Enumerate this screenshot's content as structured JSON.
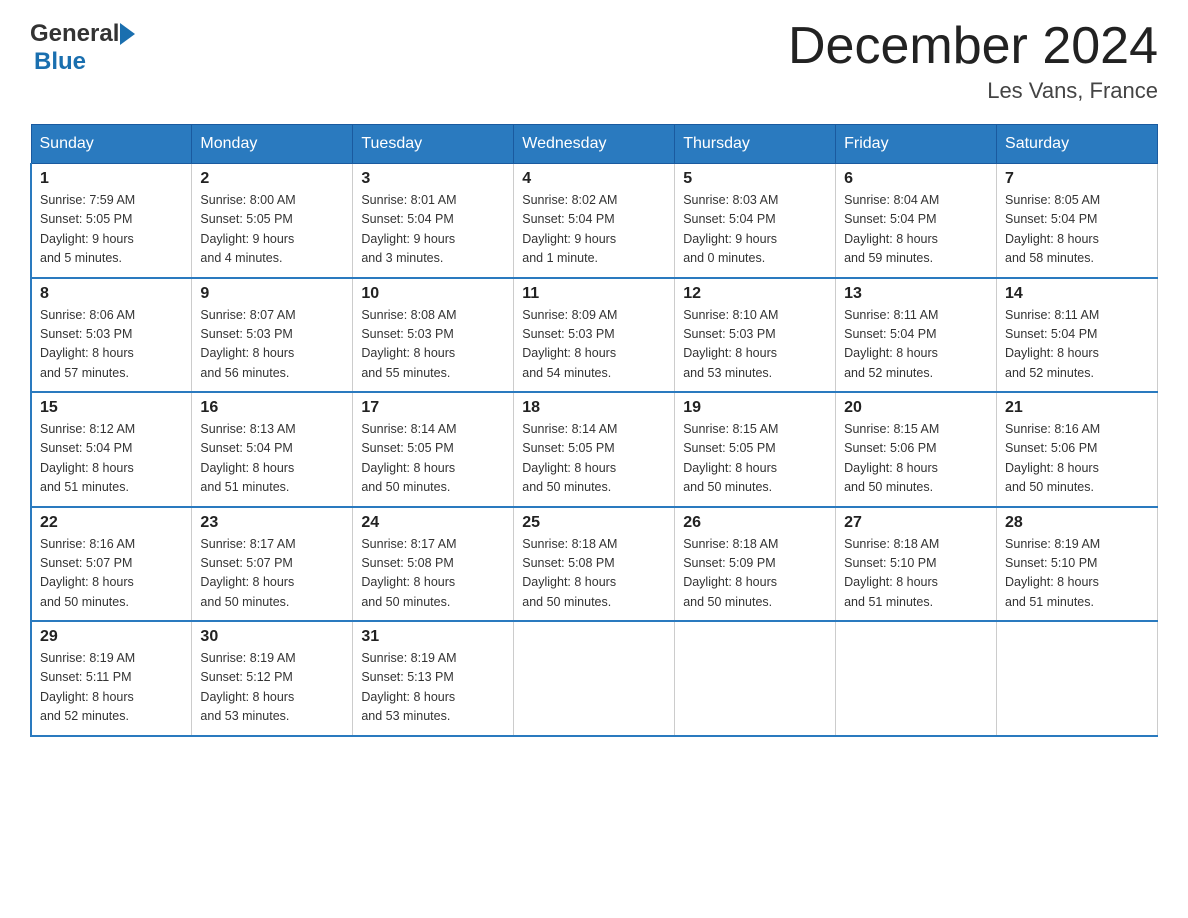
{
  "header": {
    "logo_general": "General",
    "logo_blue": "Blue",
    "month_title": "December 2024",
    "location": "Les Vans, France"
  },
  "days_of_week": [
    "Sunday",
    "Monday",
    "Tuesday",
    "Wednesday",
    "Thursday",
    "Friday",
    "Saturday"
  ],
  "weeks": [
    [
      {
        "day": "1",
        "sunrise": "Sunrise: 7:59 AM",
        "sunset": "Sunset: 5:05 PM",
        "daylight": "Daylight: 9 hours and 5 minutes."
      },
      {
        "day": "2",
        "sunrise": "Sunrise: 8:00 AM",
        "sunset": "Sunset: 5:05 PM",
        "daylight": "Daylight: 9 hours and 4 minutes."
      },
      {
        "day": "3",
        "sunrise": "Sunrise: 8:01 AM",
        "sunset": "Sunset: 5:04 PM",
        "daylight": "Daylight: 9 hours and 3 minutes."
      },
      {
        "day": "4",
        "sunrise": "Sunrise: 8:02 AM",
        "sunset": "Sunset: 5:04 PM",
        "daylight": "Daylight: 9 hours and 1 minute."
      },
      {
        "day": "5",
        "sunrise": "Sunrise: 8:03 AM",
        "sunset": "Sunset: 5:04 PM",
        "daylight": "Daylight: 9 hours and 0 minutes."
      },
      {
        "day": "6",
        "sunrise": "Sunrise: 8:04 AM",
        "sunset": "Sunset: 5:04 PM",
        "daylight": "Daylight: 8 hours and 59 minutes."
      },
      {
        "day": "7",
        "sunrise": "Sunrise: 8:05 AM",
        "sunset": "Sunset: 5:04 PM",
        "daylight": "Daylight: 8 hours and 58 minutes."
      }
    ],
    [
      {
        "day": "8",
        "sunrise": "Sunrise: 8:06 AM",
        "sunset": "Sunset: 5:03 PM",
        "daylight": "Daylight: 8 hours and 57 minutes."
      },
      {
        "day": "9",
        "sunrise": "Sunrise: 8:07 AM",
        "sunset": "Sunset: 5:03 PM",
        "daylight": "Daylight: 8 hours and 56 minutes."
      },
      {
        "day": "10",
        "sunrise": "Sunrise: 8:08 AM",
        "sunset": "Sunset: 5:03 PM",
        "daylight": "Daylight: 8 hours and 55 minutes."
      },
      {
        "day": "11",
        "sunrise": "Sunrise: 8:09 AM",
        "sunset": "Sunset: 5:03 PM",
        "daylight": "Daylight: 8 hours and 54 minutes."
      },
      {
        "day": "12",
        "sunrise": "Sunrise: 8:10 AM",
        "sunset": "Sunset: 5:03 PM",
        "daylight": "Daylight: 8 hours and 53 minutes."
      },
      {
        "day": "13",
        "sunrise": "Sunrise: 8:11 AM",
        "sunset": "Sunset: 5:04 PM",
        "daylight": "Daylight: 8 hours and 52 minutes."
      },
      {
        "day": "14",
        "sunrise": "Sunrise: 8:11 AM",
        "sunset": "Sunset: 5:04 PM",
        "daylight": "Daylight: 8 hours and 52 minutes."
      }
    ],
    [
      {
        "day": "15",
        "sunrise": "Sunrise: 8:12 AM",
        "sunset": "Sunset: 5:04 PM",
        "daylight": "Daylight: 8 hours and 51 minutes."
      },
      {
        "day": "16",
        "sunrise": "Sunrise: 8:13 AM",
        "sunset": "Sunset: 5:04 PM",
        "daylight": "Daylight: 8 hours and 51 minutes."
      },
      {
        "day": "17",
        "sunrise": "Sunrise: 8:14 AM",
        "sunset": "Sunset: 5:05 PM",
        "daylight": "Daylight: 8 hours and 50 minutes."
      },
      {
        "day": "18",
        "sunrise": "Sunrise: 8:14 AM",
        "sunset": "Sunset: 5:05 PM",
        "daylight": "Daylight: 8 hours and 50 minutes."
      },
      {
        "day": "19",
        "sunrise": "Sunrise: 8:15 AM",
        "sunset": "Sunset: 5:05 PM",
        "daylight": "Daylight: 8 hours and 50 minutes."
      },
      {
        "day": "20",
        "sunrise": "Sunrise: 8:15 AM",
        "sunset": "Sunset: 5:06 PM",
        "daylight": "Daylight: 8 hours and 50 minutes."
      },
      {
        "day": "21",
        "sunrise": "Sunrise: 8:16 AM",
        "sunset": "Sunset: 5:06 PM",
        "daylight": "Daylight: 8 hours and 50 minutes."
      }
    ],
    [
      {
        "day": "22",
        "sunrise": "Sunrise: 8:16 AM",
        "sunset": "Sunset: 5:07 PM",
        "daylight": "Daylight: 8 hours and 50 minutes."
      },
      {
        "day": "23",
        "sunrise": "Sunrise: 8:17 AM",
        "sunset": "Sunset: 5:07 PM",
        "daylight": "Daylight: 8 hours and 50 minutes."
      },
      {
        "day": "24",
        "sunrise": "Sunrise: 8:17 AM",
        "sunset": "Sunset: 5:08 PM",
        "daylight": "Daylight: 8 hours and 50 minutes."
      },
      {
        "day": "25",
        "sunrise": "Sunrise: 8:18 AM",
        "sunset": "Sunset: 5:08 PM",
        "daylight": "Daylight: 8 hours and 50 minutes."
      },
      {
        "day": "26",
        "sunrise": "Sunrise: 8:18 AM",
        "sunset": "Sunset: 5:09 PM",
        "daylight": "Daylight: 8 hours and 50 minutes."
      },
      {
        "day": "27",
        "sunrise": "Sunrise: 8:18 AM",
        "sunset": "Sunset: 5:10 PM",
        "daylight": "Daylight: 8 hours and 51 minutes."
      },
      {
        "day": "28",
        "sunrise": "Sunrise: 8:19 AM",
        "sunset": "Sunset: 5:10 PM",
        "daylight": "Daylight: 8 hours and 51 minutes."
      }
    ],
    [
      {
        "day": "29",
        "sunrise": "Sunrise: 8:19 AM",
        "sunset": "Sunset: 5:11 PM",
        "daylight": "Daylight: 8 hours and 52 minutes."
      },
      {
        "day": "30",
        "sunrise": "Sunrise: 8:19 AM",
        "sunset": "Sunset: 5:12 PM",
        "daylight": "Daylight: 8 hours and 53 minutes."
      },
      {
        "day": "31",
        "sunrise": "Sunrise: 8:19 AM",
        "sunset": "Sunset: 5:13 PM",
        "daylight": "Daylight: 8 hours and 53 minutes."
      },
      null,
      null,
      null,
      null
    ]
  ]
}
